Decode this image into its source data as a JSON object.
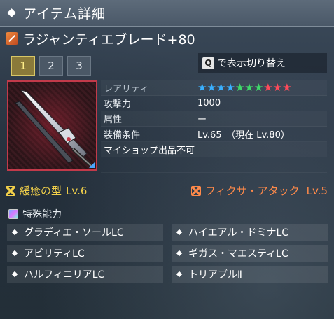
{
  "header": {
    "title": "アイテム詳細"
  },
  "item": {
    "name": "ラジャンティエブレード+80",
    "icon": "sword-icon"
  },
  "tabs": [
    {
      "label": "1",
      "active": true
    },
    {
      "label": "2",
      "active": false
    },
    {
      "label": "3",
      "active": false
    }
  ],
  "switch_button": {
    "key": "Q",
    "label": "で表示切り替え"
  },
  "stats": {
    "rarity_label": "レアリティ",
    "rarity_stars": [
      "#3ab0ff",
      "#3ab0ff",
      "#3ab0ff",
      "#3ab0ff",
      "#3fd86a",
      "#3fd86a",
      "#3fd86a",
      "#ff4a5a",
      "#ff4a5a",
      "#ff4a5a"
    ],
    "attack_label": "攻撃力",
    "attack_value": "1000",
    "element_label": "属性",
    "element_value": "ー",
    "equip_label": "装備条件",
    "equip_value": "Lv.65　（現在 Lv.80）",
    "note": "マイショップ出品不可"
  },
  "abilities": {
    "left_name": "緩癒の型",
    "left_level": "Lv.6",
    "right_name": "フィクサ・アタック",
    "right_level": "Lv.5"
  },
  "special": {
    "heading": "特殊能力",
    "items": [
      "グラディエ・ソールLC",
      "ハイエアル・ドミナLC",
      "アビリティLC",
      "ギガス・マエスティLC",
      "ハルフィニリアLC",
      "トリアブルⅡ"
    ]
  }
}
